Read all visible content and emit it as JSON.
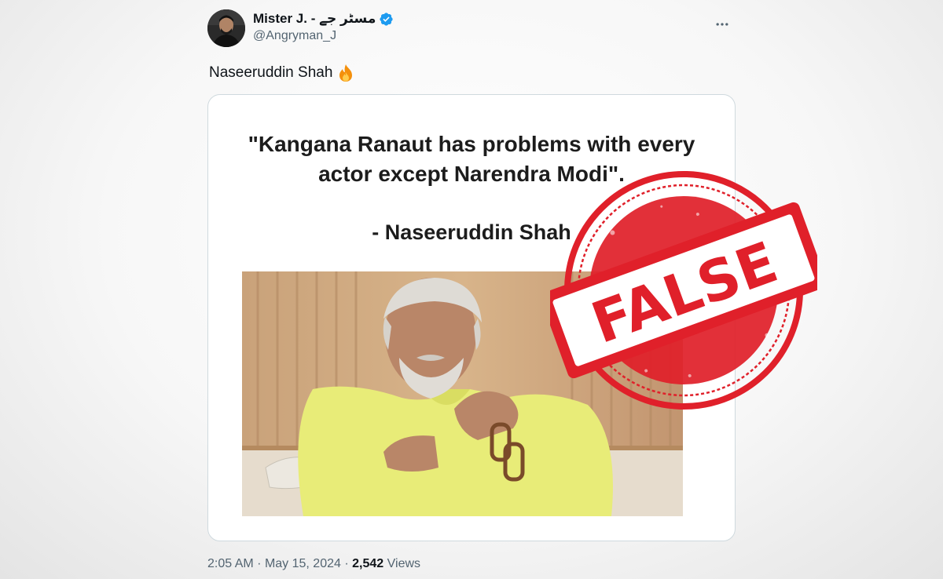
{
  "author": {
    "name": "Mister J. - مسٹر جے",
    "handle": "@Angryman_J",
    "verified": true
  },
  "tweet": {
    "text": "Naseeruddin Shah",
    "emoji_icon": "fire-icon"
  },
  "media": {
    "quote_line1": "\"Kangana Ranaut has problems with every",
    "quote_line2": "actor except Narendra Modi\".",
    "attribution": "- Naseeruddin Shah"
  },
  "meta": {
    "time": "2:05 AM",
    "separator": "·",
    "date": "May 15, 2024",
    "views_count": "2,542",
    "views_label": "Views"
  },
  "stamp": {
    "text": "FALSE",
    "color": "#e0202a"
  },
  "colors": {
    "verified_blue": "#1d9bf0",
    "secondary_text": "#536471",
    "shirt_yellow": "#e8ec78"
  }
}
